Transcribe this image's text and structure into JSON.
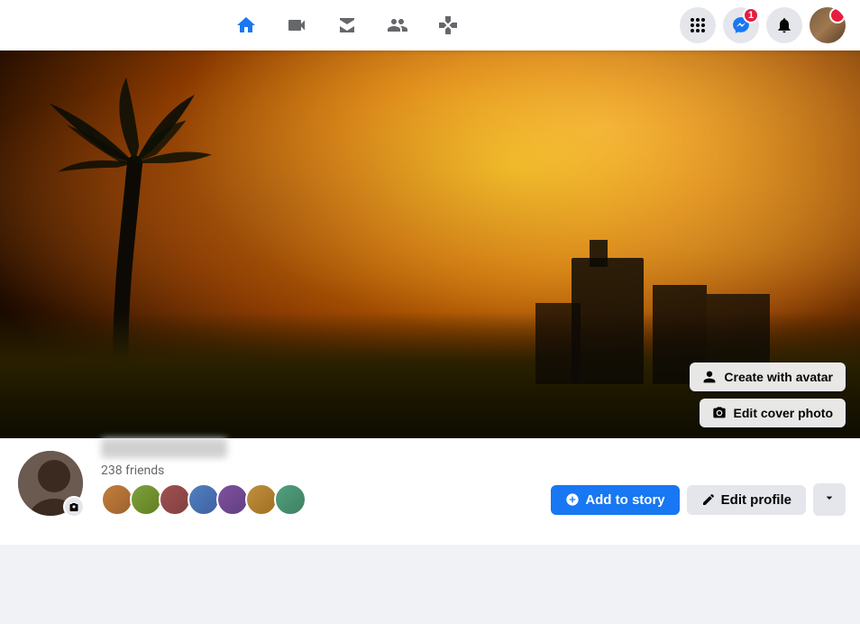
{
  "nav": {
    "icons": [
      {
        "name": "home-icon",
        "symbol": "🏠",
        "active": true
      },
      {
        "name": "video-icon",
        "symbol": "▶",
        "active": false
      },
      {
        "name": "store-icon",
        "symbol": "🏪",
        "active": false
      },
      {
        "name": "groups-icon",
        "symbol": "👥",
        "active": false
      },
      {
        "name": "gaming-icon",
        "symbol": "🎮",
        "active": false
      }
    ],
    "right_icons": [
      {
        "name": "grid-icon",
        "symbol": "⊞",
        "badge": null
      },
      {
        "name": "messenger-icon",
        "symbol": "💬",
        "badge": "1"
      },
      {
        "name": "notifications-icon",
        "symbol": "🔔",
        "badge": null
      }
    ]
  },
  "cover": {
    "create_with_avatar_label": "Create with avatar",
    "edit_cover_photo_label": "Edit cover photo"
  },
  "profile": {
    "friends_count": "238 friends",
    "add_to_story_label": "Add to story",
    "edit_profile_label": "Edit profile",
    "more_symbol": "›",
    "camera_symbol": "📷"
  }
}
